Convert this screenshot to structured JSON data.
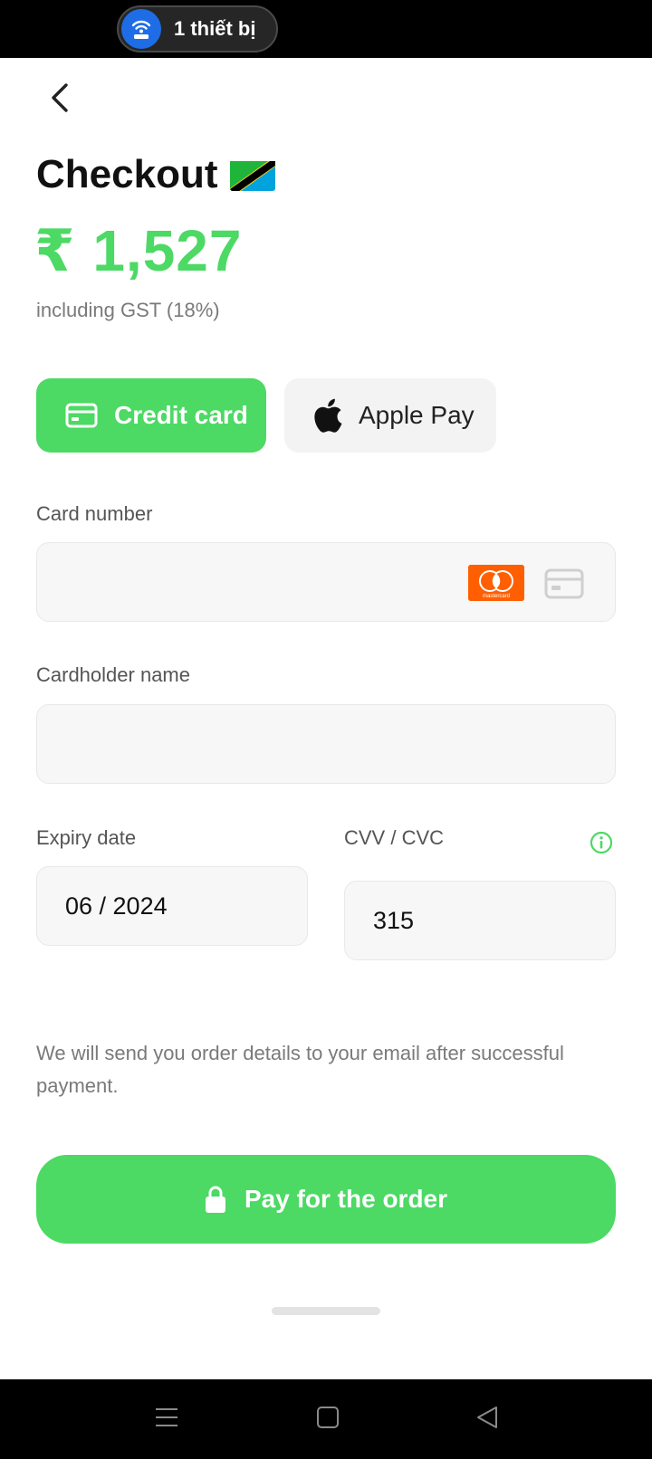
{
  "status_bar": {
    "hotspot_label": "1 thiết bị"
  },
  "header": {
    "title": "Checkout",
    "flag_icon": "tanzania-flag-icon"
  },
  "price": {
    "amount": "₹ 1,527",
    "tax_note": "including GST (18%)"
  },
  "payment_methods": [
    {
      "label": "Credit card",
      "icon": "credit-card-icon",
      "selected": true
    },
    {
      "label": "Apple Pay",
      "icon": "apple-icon",
      "selected": false
    }
  ],
  "form": {
    "card_number": {
      "label": "Card number",
      "value": "",
      "brand_icon": "mastercard-icon",
      "brand_text": "mastercard"
    },
    "cardholder": {
      "label": "Cardholder name",
      "value": ""
    },
    "expiry": {
      "label": "Expiry date",
      "value": "06 / 2024"
    },
    "cvv": {
      "label": "CVV / CVC",
      "value": "315",
      "info_icon": "info-icon"
    }
  },
  "notice": "We will send you order details to your email after successful payment.",
  "pay_button": {
    "label": "Pay for the order",
    "icon": "lock-icon"
  },
  "colors": {
    "accent": "#4cd964",
    "field_bg": "#f7f7f7",
    "mastercard": "#ff5f00"
  }
}
